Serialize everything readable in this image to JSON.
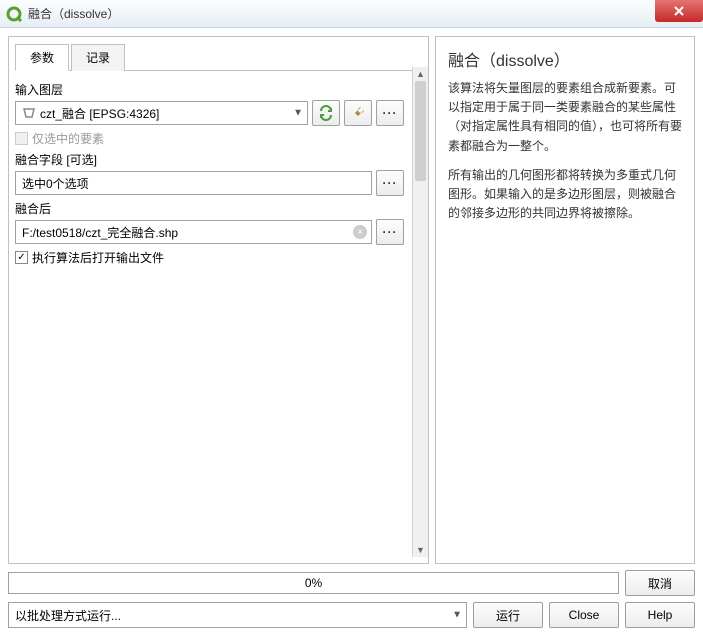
{
  "title": "融合（dissolve）",
  "tabs": {
    "params": "参数",
    "log": "记录"
  },
  "labels": {
    "inputLayer": "输入图层",
    "selectedOnly": "仅选中的要素",
    "dissolveField": "融合字段 [可选]",
    "fieldSelected": "选中0个选项",
    "output": "融合后",
    "openOutput": "执行算法后打开输出文件"
  },
  "values": {
    "inputLayer": "czt_融合 [EPSG:4326]",
    "outputPath": "F:/test0518/czt_完全融合.shp"
  },
  "help": {
    "heading": "融合（dissolve）",
    "p1": "该算法将矢量图层的要素组合成新要素。可以指定用于属于同一类要素融合的某些属性（对指定属性具有相同的值），也可将所有要素都融合为一整个。",
    "p2": "所有输出的几何图形都将转换为多重式几何图形。如果输入的是多边形图层，则被融合的邻接多边形的共同边界将被擦除。"
  },
  "progress": "0%",
  "buttons": {
    "cancel": "取消",
    "run": "运行",
    "close": "Close",
    "help": "Help"
  },
  "batch": "以批处理方式运行..."
}
